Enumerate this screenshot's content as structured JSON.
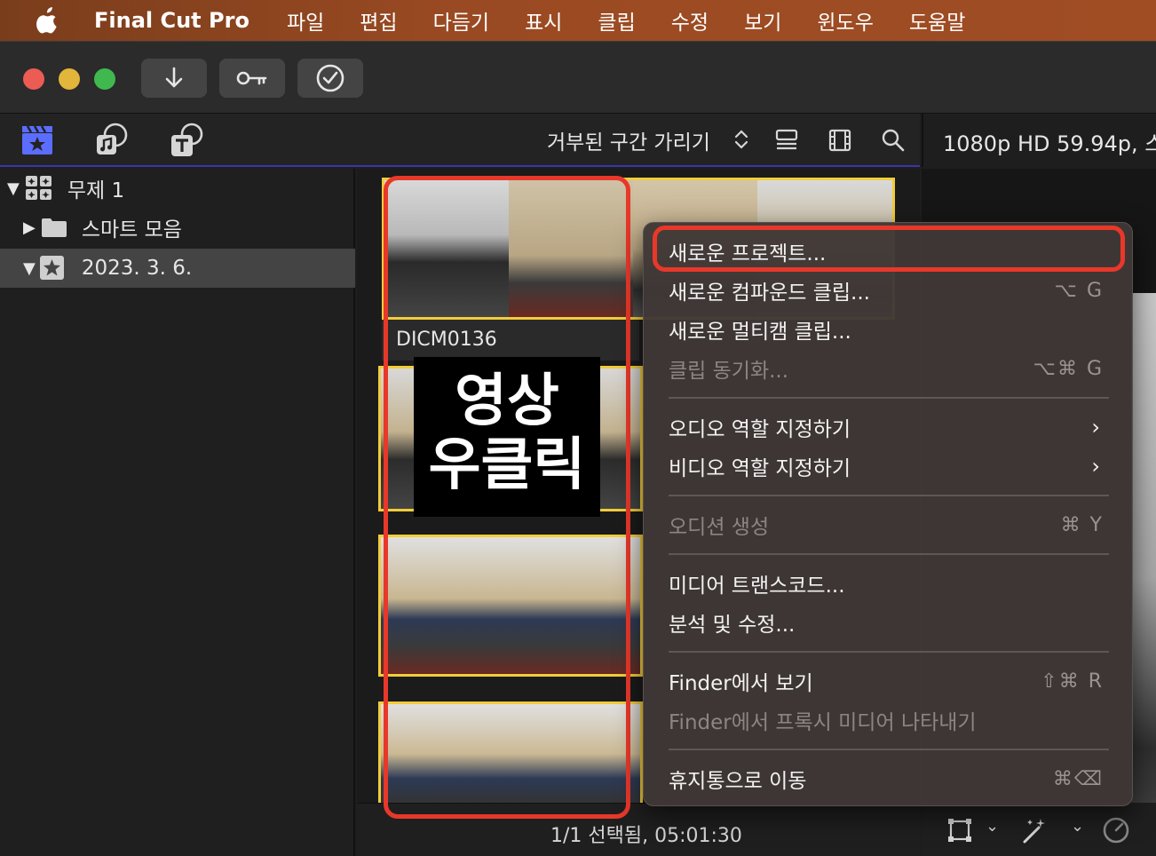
{
  "menubar": {
    "app_name": "Final Cut Pro",
    "items": [
      "파일",
      "편집",
      "다듬기",
      "표시",
      "클립",
      "수정",
      "보기",
      "윈도우",
      "도움말"
    ]
  },
  "toolbar": {
    "buttons": [
      {
        "icon": "download-arrow-icon"
      },
      {
        "icon": "key-icon"
      },
      {
        "icon": "checkmark-circle-icon"
      }
    ]
  },
  "browser_header": {
    "filter_label": "거부된 구간 가리기",
    "viewer_format": "1080p HD 59.94p, 스"
  },
  "sidebar": {
    "items": [
      {
        "label": "무제 1",
        "icon": "library-icon",
        "expanded": true
      },
      {
        "label": "스마트 모음",
        "icon": "folder-icon",
        "expanded": false
      },
      {
        "label": "2023. 3. 6.",
        "icon": "event-star-icon",
        "expanded": true,
        "selected": true
      }
    ]
  },
  "clip": {
    "name": "DICM0136"
  },
  "annotation": {
    "line1": "영상",
    "line2": "우클릭"
  },
  "context_menu": {
    "items": [
      {
        "label": "새로운 프로젝트...",
        "shortcut": "",
        "enabled": true,
        "highlighted": true
      },
      {
        "label": "새로운 컴파운드 클립...",
        "shortcut": "⌥ G",
        "enabled": true
      },
      {
        "label": "새로운 멀티캠 클립...",
        "shortcut": "",
        "enabled": true
      },
      {
        "label": "클립 동기화...",
        "shortcut": "⌥⌘ G",
        "enabled": false
      },
      {
        "label": "오디오 역할 지정하기",
        "shortcut": "",
        "enabled": true,
        "submenu": true
      },
      {
        "label": "비디오 역할 지정하기",
        "shortcut": "",
        "enabled": true,
        "submenu": true
      },
      {
        "label": "오디션 생성",
        "shortcut": "⌘ Y",
        "enabled": false
      },
      {
        "label": "미디어 트랜스코드...",
        "shortcut": "",
        "enabled": true
      },
      {
        "label": "분석 및 수정...",
        "shortcut": "",
        "enabled": true
      },
      {
        "label": "Finder에서 보기",
        "shortcut": "⇧⌘ R",
        "enabled": true
      },
      {
        "label": "Finder에서 프록시 미디어 나타내기",
        "shortcut": "",
        "enabled": false
      },
      {
        "label": "휴지통으로 이동",
        "shortcut": "⌘⌫",
        "enabled": true
      }
    ]
  },
  "status": {
    "selection": "1/1 선택됨, 05:01:30"
  },
  "colors": {
    "menubar": "#9a4a22",
    "highlight_red": "#e8382a",
    "clip_border": "#f2cd3b",
    "header_accent": "#3a37a8"
  }
}
